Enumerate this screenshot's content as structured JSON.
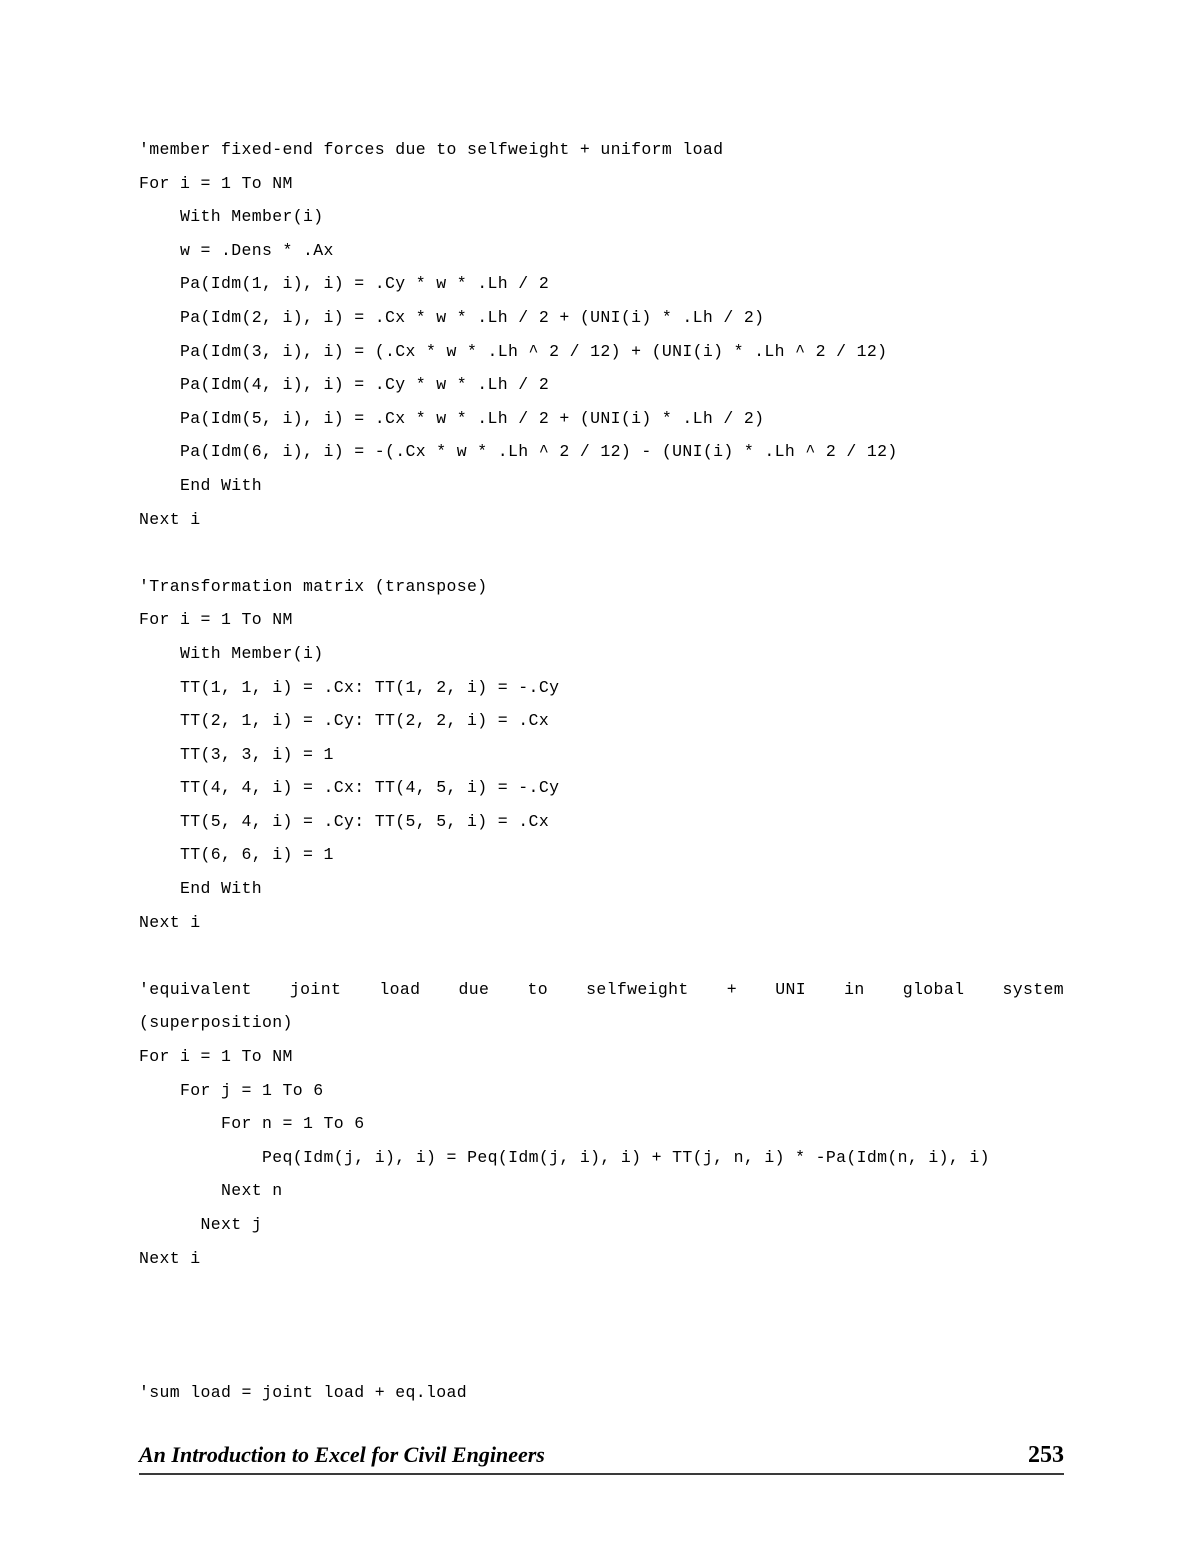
{
  "page": {
    "number": "253",
    "background": "#ffffff",
    "text_color": "#000000"
  },
  "code": {
    "blocks": [
      {
        "name": "fixed-end-forces",
        "lines": [
          "'member fixed-end forces due to selfweight + uniform load",
          "For i = 1 To NM",
          "    With Member(i)",
          "    w = .Dens * .Ax",
          "    Pa(Idm(1, i), i) = .Cy * w * .Lh / 2",
          "    Pa(Idm(2, i), i) = .Cx * w * .Lh / 2 + (UNI(i) * .Lh / 2)",
          "    Pa(Idm(3, i), i) = (.Cx * w * .Lh ^ 2 / 12) + (UNI(i) * .Lh ^ 2 / 12)",
          "    Pa(Idm(4, i), i) = .Cy * w * .Lh / 2",
          "    Pa(Idm(5, i), i) = .Cx * w * .Lh / 2 + (UNI(i) * .Lh / 2)",
          "    Pa(Idm(6, i), i) = -(.Cx * w * .Lh ^ 2 / 12) - (UNI(i) * .Lh ^ 2 / 12)",
          "    End With",
          "Next i",
          ""
        ]
      },
      {
        "name": "transformation-matrix",
        "lines": [
          "'Transformation matrix (transpose)",
          "For i = 1 To NM",
          "    With Member(i)",
          "    TT(1, 1, i) = .Cx: TT(1, 2, i) = -.Cy",
          "    TT(2, 1, i) = .Cy: TT(2, 2, i) = .Cx",
          "    TT(3, 3, i) = 1",
          "    TT(4, 4, i) = .Cx: TT(4, 5, i) = -.Cy",
          "    TT(5, 4, i) = .Cy: TT(5, 5, i) = .Cx",
          "    TT(6, 6, i) = 1",
          "    End With",
          "Next i",
          ""
        ]
      }
    ],
    "equivalent_joint_load": {
      "comment_justified": "'equivalent joint load due to selfweight + UNI in global system",
      "comment_tail": "(superposition)",
      "lines_before_wrap": [
        "For i = 1 To NM",
        "    For j = 1 To 6",
        "        For n = 1 To 6"
      ],
      "wrapped_statement": "            Peq(Idm(j, i), i) = Peq(Idm(j, i), i) + TT(j, n, i) * -Pa(Idm(n, i), i)",
      "lines_after_wrap": [
        "        Next n",
        "      Next j",
        "Next i",
        "",
        "",
        ""
      ]
    },
    "sum_load": {
      "lines": [
        "'sum load = joint load + eq.load"
      ]
    }
  },
  "footer": {
    "title": "An Introduction to Excel for Civil Engineers",
    "page_number": "253",
    "rule_color": "#3a3a3a"
  }
}
